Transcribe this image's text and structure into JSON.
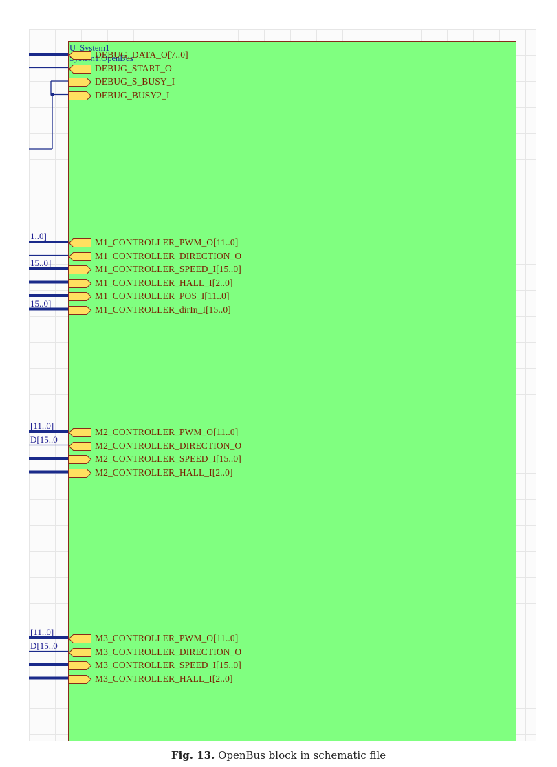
{
  "sheet_symbol": {
    "designator": "U_System1",
    "file_name": "System1.OpenBus"
  },
  "groups": [
    {
      "entries": [
        {
          "name": "DEBUG_DATA_O[7..0]",
          "io": "output"
        },
        {
          "name": "DEBUG_START_O",
          "io": "output"
        },
        {
          "name": "DEBUG_S_BUSY_I",
          "io": "input"
        },
        {
          "name": "DEBUG_BUSY2_I",
          "io": "input"
        }
      ]
    },
    {
      "entries": [
        {
          "name": "M1_CONTROLLER_PWM_O[11..0]",
          "io": "output"
        },
        {
          "name": "M1_CONTROLLER_DIRECTION_O",
          "io": "output"
        },
        {
          "name": "M1_CONTROLLER_SPEED_I[15..0]",
          "io": "input"
        },
        {
          "name": "M1_CONTROLLER_HALL_I[2..0]",
          "io": "input"
        },
        {
          "name": "M1_CONTROLLER_POS_I[11..0]",
          "io": "input"
        },
        {
          "name": "M1_CONTROLLER_dirIn_I[15..0]",
          "io": "input"
        }
      ]
    },
    {
      "entries": [
        {
          "name": "M2_CONTROLLER_PWM_O[11..0]",
          "io": "output"
        },
        {
          "name": "M2_CONTROLLER_DIRECTION_O",
          "io": "output"
        },
        {
          "name": "M2_CONTROLLER_SPEED_I[15..0]",
          "io": "input"
        },
        {
          "name": "M2_CONTROLLER_HALL_I[2..0]",
          "io": "input"
        }
      ]
    },
    {
      "entries": [
        {
          "name": "M3_CONTROLLER_PWM_O[11..0]",
          "io": "output"
        },
        {
          "name": "M3_CONTROLLER_DIRECTION_O",
          "io": "output"
        },
        {
          "name": "M3_CONTROLLER_SPEED_I[15..0]",
          "io": "input"
        },
        {
          "name": "M3_CONTROLLER_HALL_I[2..0]",
          "io": "input"
        }
      ]
    }
  ],
  "net_labels": [
    "1..0]",
    "15..0]",
    "15..0]",
    "[11..0]",
    "D[15..0",
    "[11..0]",
    "D[15..0"
  ],
  "caption": {
    "figure": "Fig. 13.",
    "text": "OpenBus block in schematic file"
  },
  "colors": {
    "block_fill": "#80ff80",
    "block_border": "#8a2a1a",
    "entry_fill": "#ffe060",
    "entry_border": "#8a2a1a",
    "pin_text": "#7a1e00",
    "wire": "#1a2a8a",
    "title_text": "#1a2a9a"
  }
}
